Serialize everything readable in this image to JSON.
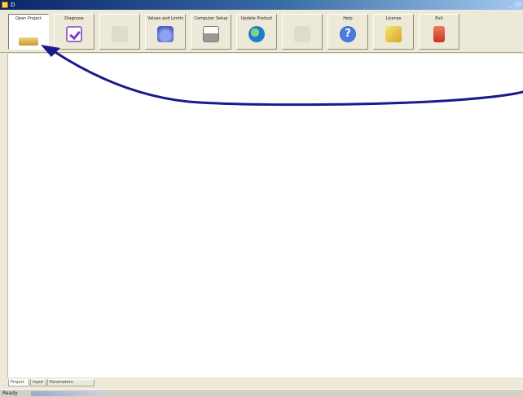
{
  "window": {
    "title": "D",
    "title_right": "_ 10"
  },
  "toolbar": {
    "buttons": [
      {
        "label": "Open Project",
        "icon": "folder-icon",
        "state": "active"
      },
      {
        "label": "Diagnose",
        "icon": "checklist-icon",
        "state": "normal"
      },
      {
        "label": "",
        "icon": "disabled-icon",
        "state": "disabled"
      },
      {
        "label": "Values and Limits",
        "icon": "jar-icon",
        "state": "normal"
      },
      {
        "label": "Computer Setup",
        "icon": "printer-icon",
        "state": "normal"
      },
      {
        "label": "Update Product",
        "icon": "globe-icon",
        "state": "normal"
      },
      {
        "label": "",
        "icon": "disabled-icon",
        "state": "disabled"
      },
      {
        "label": "Help",
        "icon": "help-icon",
        "state": "normal"
      },
      {
        "label": "License",
        "icon": "key-icon",
        "state": "normal"
      },
      {
        "label": "Exit",
        "icon": "exit-icon",
        "state": "normal"
      }
    ]
  },
  "tabs": [
    {
      "label": "Project",
      "selected": true
    },
    {
      "label": "Input",
      "selected": false
    },
    {
      "label": "Parameters",
      "selected": false
    }
  ],
  "status": {
    "text": "Ready",
    "right": ""
  },
  "colors": {
    "arrow": "#1a1a8c",
    "titlebar": "#0a246a"
  }
}
